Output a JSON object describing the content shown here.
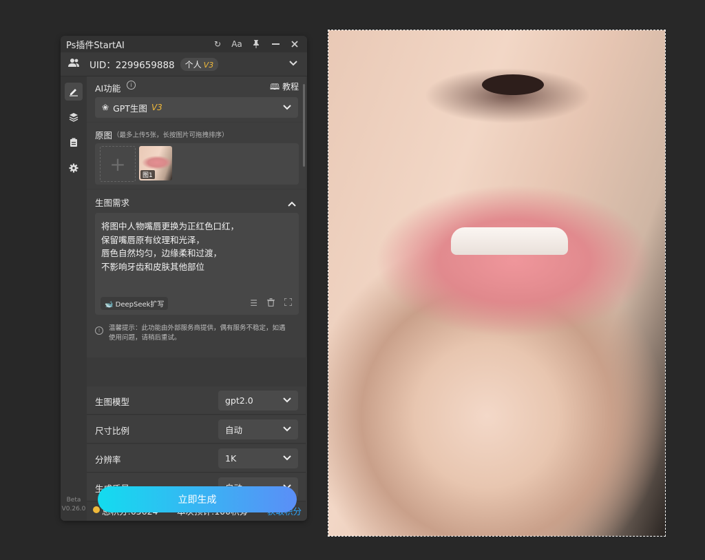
{
  "window": {
    "title": "Ps插件StartAI"
  },
  "titlebar": {
    "refresh_icon": "refresh-icon",
    "font_icon_label": "Aa",
    "pin_icon": "pin-icon",
    "minimize_icon": "minimize-icon",
    "close_icon": "close-icon"
  },
  "user": {
    "uid_label": "UID：2299659888",
    "plan": "个人",
    "plan_version": "V3"
  },
  "sidebar": {
    "items": [
      "edit-icon",
      "layers-icon",
      "clipboard-icon",
      "settings-icon"
    ],
    "version_line1": "Beta",
    "version_line2": "V0.26.0"
  },
  "ai_function": {
    "label": "AI功能",
    "tutorial": "教程",
    "selected": "GPT生图",
    "selected_version": "V3"
  },
  "original_image": {
    "label": "原图",
    "hint": "（最多上传5张，长按图片可拖拽排序）",
    "thumb_label": "图1"
  },
  "prompt": {
    "label": "生图需求",
    "lines": [
      "将图中人物嘴唇更换为正红色口红，",
      "保留嘴唇原有纹理和光泽，",
      "唇色自然均匀，边缘柔和过渡，",
      "不影响牙齿和皮肤其他部位"
    ],
    "deepseek": "DeepSeek扩写"
  },
  "notice": {
    "text_line1": "温馨提示：此功能由外部服务商提供，偶有服务不稳定，如遇",
    "text_line2": "使用问题，请稍后重试。"
  },
  "settings": [
    {
      "label": "生图模型",
      "value": "gpt2.0"
    },
    {
      "label": "尺寸比例",
      "value": "自动"
    },
    {
      "label": "分辨率",
      "value": "1K"
    },
    {
      "label": "生成质量",
      "value": "自动"
    }
  ],
  "points": {
    "total": "总积分:65624",
    "estimate": "本次预计:100积分",
    "get_points": "获取积分"
  },
  "generate": {
    "label": "立即生成"
  },
  "colors": {
    "accent_gold": "#f0b93a",
    "link_blue": "#2ea7ff",
    "gradient_start": "#13dcef",
    "gradient_end": "#5b8ef7"
  }
}
